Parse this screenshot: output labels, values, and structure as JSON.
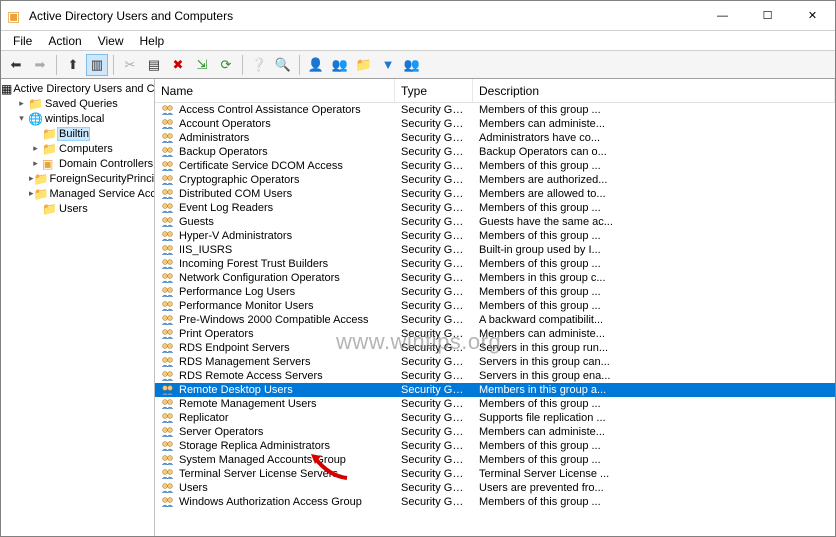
{
  "window": {
    "title": "Active Directory Users and Computers"
  },
  "menu": {
    "items": [
      "File",
      "Action",
      "View",
      "Help"
    ]
  },
  "tree": {
    "root": "Active Directory Users and Com",
    "nodes": [
      {
        "label": "Saved Queries",
        "depth": 1,
        "arrow": "▸",
        "icon": "folder"
      },
      {
        "label": "wintips.local",
        "depth": 1,
        "arrow": "▾",
        "icon": "domain"
      },
      {
        "label": "Builtin",
        "depth": 2,
        "arrow": "",
        "icon": "folder",
        "selected": true
      },
      {
        "label": "Computers",
        "depth": 2,
        "arrow": "▸",
        "icon": "folder"
      },
      {
        "label": "Domain Controllers",
        "depth": 2,
        "arrow": "▸",
        "icon": "ou"
      },
      {
        "label": "ForeignSecurityPrincipals",
        "depth": 2,
        "arrow": "▸",
        "icon": "folder"
      },
      {
        "label": "Managed Service Accoun",
        "depth": 2,
        "arrow": "▸",
        "icon": "folder"
      },
      {
        "label": "Users",
        "depth": 2,
        "arrow": "",
        "icon": "folder"
      }
    ]
  },
  "columns": {
    "name": "Name",
    "type": "Type",
    "desc": "Description"
  },
  "rows": [
    {
      "name": "Access Control Assistance Operators",
      "type": "Security Group...",
      "desc": "Members of this group ..."
    },
    {
      "name": "Account Operators",
      "type": "Security Group...",
      "desc": "Members can administe..."
    },
    {
      "name": "Administrators",
      "type": "Security Group...",
      "desc": "Administrators have co..."
    },
    {
      "name": "Backup Operators",
      "type": "Security Group...",
      "desc": "Backup Operators can o..."
    },
    {
      "name": "Certificate Service DCOM Access",
      "type": "Security Group...",
      "desc": "Members of this group ..."
    },
    {
      "name": "Cryptographic Operators",
      "type": "Security Group...",
      "desc": "Members are authorized..."
    },
    {
      "name": "Distributed COM Users",
      "type": "Security Group...",
      "desc": "Members are allowed to..."
    },
    {
      "name": "Event Log Readers",
      "type": "Security Group...",
      "desc": "Members of this group ..."
    },
    {
      "name": "Guests",
      "type": "Security Group...",
      "desc": "Guests have the same ac..."
    },
    {
      "name": "Hyper-V Administrators",
      "type": "Security Group...",
      "desc": "Members of this group ..."
    },
    {
      "name": "IIS_IUSRS",
      "type": "Security Group...",
      "desc": "Built-in group used by I..."
    },
    {
      "name": "Incoming Forest Trust Builders",
      "type": "Security Group...",
      "desc": "Members of this group ..."
    },
    {
      "name": "Network Configuration Operators",
      "type": "Security Group...",
      "desc": "Members in this group c..."
    },
    {
      "name": "Performance Log Users",
      "type": "Security Group...",
      "desc": "Members of this group ..."
    },
    {
      "name": "Performance Monitor Users",
      "type": "Security Group...",
      "desc": "Members of this group ..."
    },
    {
      "name": "Pre-Windows 2000 Compatible Access",
      "type": "Security Group...",
      "desc": "A backward compatibilit..."
    },
    {
      "name": "Print Operators",
      "type": "Security Group...",
      "desc": "Members can administe..."
    },
    {
      "name": "RDS Endpoint Servers",
      "type": "Security Group...",
      "desc": "Servers in this group run..."
    },
    {
      "name": "RDS Management Servers",
      "type": "Security Group...",
      "desc": "Servers in this group can..."
    },
    {
      "name": "RDS Remote Access Servers",
      "type": "Security Group...",
      "desc": "Servers in this group ena..."
    },
    {
      "name": "Remote Desktop Users",
      "type": "Security Group...",
      "desc": "Members in this group a...",
      "selected": true
    },
    {
      "name": "Remote Management Users",
      "type": "Security Group...",
      "desc": "Members of this group ..."
    },
    {
      "name": "Replicator",
      "type": "Security Group...",
      "desc": "Supports file replication ..."
    },
    {
      "name": "Server Operators",
      "type": "Security Group...",
      "desc": "Members can administe..."
    },
    {
      "name": "Storage Replica Administrators",
      "type": "Security Group...",
      "desc": "Members of this group ..."
    },
    {
      "name": "System Managed Accounts Group",
      "type": "Security Group...",
      "desc": "Members of this group ..."
    },
    {
      "name": "Terminal Server License Servers",
      "type": "Security Group...",
      "desc": "Terminal Server License ..."
    },
    {
      "name": "Users",
      "type": "Security Group...",
      "desc": "Users are prevented fro..."
    },
    {
      "name": "Windows Authorization Access Group",
      "type": "Security Group...",
      "desc": "Members of this group ..."
    }
  ],
  "watermark": "www.wintips.org"
}
